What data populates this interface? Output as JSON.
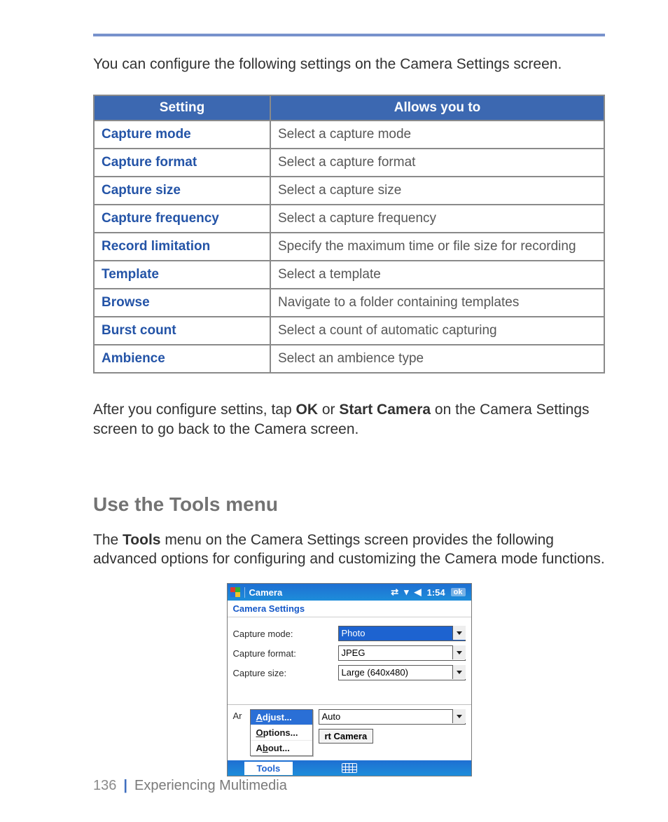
{
  "intro": "You can configure the following settings on the Camera Settings screen.",
  "table": {
    "headers": {
      "setting": "Setting",
      "allows": "Allows you to"
    },
    "rows": [
      {
        "name": "Capture mode",
        "desc": "Select a capture mode"
      },
      {
        "name": "Capture format",
        "desc": "Select a capture format"
      },
      {
        "name": "Capture size",
        "desc": "Select a capture size"
      },
      {
        "name": "Capture frequency",
        "desc": "Select a capture frequency"
      },
      {
        "name": "Record limitation",
        "desc": "Specify the maximum time or file size for recording"
      },
      {
        "name": "Template",
        "desc": "Select a template"
      },
      {
        "name": "Browse",
        "desc": "Navigate to a folder containing templates"
      },
      {
        "name": "Burst count",
        "desc": "Select a count of automatic capturing"
      },
      {
        "name": "Ambience",
        "desc": "Select an ambience type"
      }
    ]
  },
  "post_table": {
    "pre": "After you configure settins, tap ",
    "bold1": "OK",
    "mid": " or ",
    "bold2": "Start Camera",
    "post": " on the Camera Settings screen to go back to the Camera screen."
  },
  "section2": {
    "heading": "Use the Tools menu",
    "body_pre": "The ",
    "body_bold": "Tools",
    "body_post": " menu on the Camera Settings screen provides the following advanced options for configuring and customizing the Camera mode functions."
  },
  "device": {
    "title": "Camera",
    "clock": "1:54",
    "ok": "ok",
    "panel_title": "Camera Settings",
    "rows": {
      "mode": {
        "label": "Capture mode:",
        "value": "Photo"
      },
      "format": {
        "label": "Capture format:",
        "value": "JPEG"
      },
      "size": {
        "label": "Capture size:",
        "value": "Large (640x480)"
      }
    },
    "ar_prefix": "Ar",
    "popup": {
      "adjust": "Adjust...",
      "options": "Options...",
      "about": "About..."
    },
    "auto_value": "Auto",
    "start_camera_btn": "rt Camera",
    "tools": "Tools"
  },
  "footer": {
    "page": "136",
    "section": "Experiencing Multimedia"
  }
}
